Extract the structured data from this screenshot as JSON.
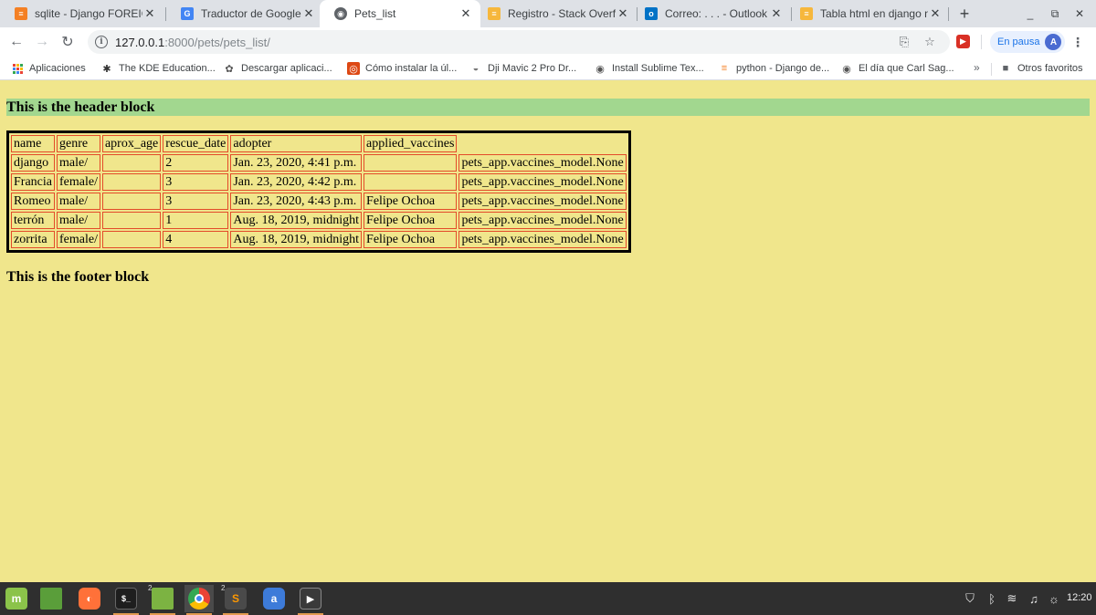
{
  "browser": {
    "tabs": [
      {
        "title": "sqlite - Django FOREIGN",
        "icon": "stackoverflow-icon",
        "active": false
      },
      {
        "title": "Traductor de Google",
        "icon": "google-translate-icon",
        "active": false
      },
      {
        "title": "Pets_list",
        "icon": "globe-icon",
        "active": true
      },
      {
        "title": "Registro - Stack Overflo",
        "icon": "stackexchange-icon",
        "active": false
      },
      {
        "title": "Correo: . . . - Outlook",
        "icon": "outlook-icon",
        "active": false
      },
      {
        "title": "Tabla html en django no",
        "icon": "stackexchange-icon",
        "active": false
      }
    ],
    "address": {
      "host": "127.0.0.1",
      "path": ":8000/pets/pets_list/"
    },
    "profile": {
      "status_label": "En pausa",
      "avatar_letter": "A"
    },
    "bookmarks": [
      {
        "label": "Aplicaciones",
        "icon": "apps-grid-icon"
      },
      {
        "label": "The KDE Education...",
        "icon": "kde-icon"
      },
      {
        "label": "Descargar aplicaci...",
        "icon": "puzzle-icon"
      },
      {
        "label": "Cómo instalar la úl...",
        "icon": "ubuntu-icon"
      },
      {
        "label": "Dji Mavic 2 Pro Dr...",
        "icon": "drone-icon"
      },
      {
        "label": "Install Sublime Tex...",
        "icon": "globe-icon"
      },
      {
        "label": "python - Django de...",
        "icon": "stackoverflow-icon"
      },
      {
        "label": "El día que Carl Sag...",
        "icon": "globe-icon"
      }
    ],
    "bookmarks_overflow": "»",
    "other_bookmarks": "Otros favoritos"
  },
  "page": {
    "header_text": "This is the header block",
    "footer_text": "This is the footer block",
    "table": {
      "headers": [
        "name",
        "genre",
        "aprox_age",
        "rescue_date",
        "adopter",
        "applied_vaccines"
      ],
      "rows": [
        [
          "django",
          "male/",
          "",
          "2",
          "Jan. 23, 2020, 4:41 p.m.",
          "",
          "pets_app.vaccines_model.None"
        ],
        [
          "Francia",
          "female/",
          "",
          "3",
          "Jan. 23, 2020, 4:42 p.m.",
          "",
          "pets_app.vaccines_model.None"
        ],
        [
          "Romeo",
          "male/",
          "",
          "3",
          "Jan. 23, 2020, 4:43 p.m.",
          "Felipe Ochoa",
          "pets_app.vaccines_model.None"
        ],
        [
          "terrón",
          "male/",
          "",
          "1",
          "Aug. 18, 2019, midnight",
          "Felipe Ochoa",
          "pets_app.vaccines_model.None"
        ],
        [
          "zorrita",
          "female/",
          "",
          "4",
          "Aug. 18, 2019, midnight",
          "Felipe Ochoa",
          "pets_app.vaccines_model.None"
        ]
      ]
    }
  },
  "taskbar": {
    "apps": [
      {
        "name": "mint-menu",
        "icon": "linux-mint-icon",
        "color": "#8bc34a"
      },
      {
        "name": "show-desktop",
        "icon": "desktop-icon",
        "color": "#5a9e3a"
      },
      {
        "name": "firefox",
        "icon": "firefox-icon",
        "color": "#ff7139"
      },
      {
        "name": "terminal",
        "icon": "terminal-icon",
        "color": "#1e1e1e",
        "label": "$_"
      },
      {
        "name": "files",
        "icon": "folder-icon",
        "color": "#7cb342",
        "badge": "2"
      },
      {
        "name": "chrome",
        "icon": "chrome-icon",
        "color": "#4285f4"
      },
      {
        "name": "sublime",
        "icon": "sublime-text-icon",
        "color": "#4a4a4a",
        "label": "S",
        "badge": "2"
      },
      {
        "name": "a-app",
        "icon": "a-app-icon",
        "color": "#3d7bd9",
        "label": "a"
      },
      {
        "name": "media",
        "icon": "play-icon",
        "color": "#3a3a3a",
        "label": "▶"
      }
    ],
    "clock": "12:20"
  }
}
